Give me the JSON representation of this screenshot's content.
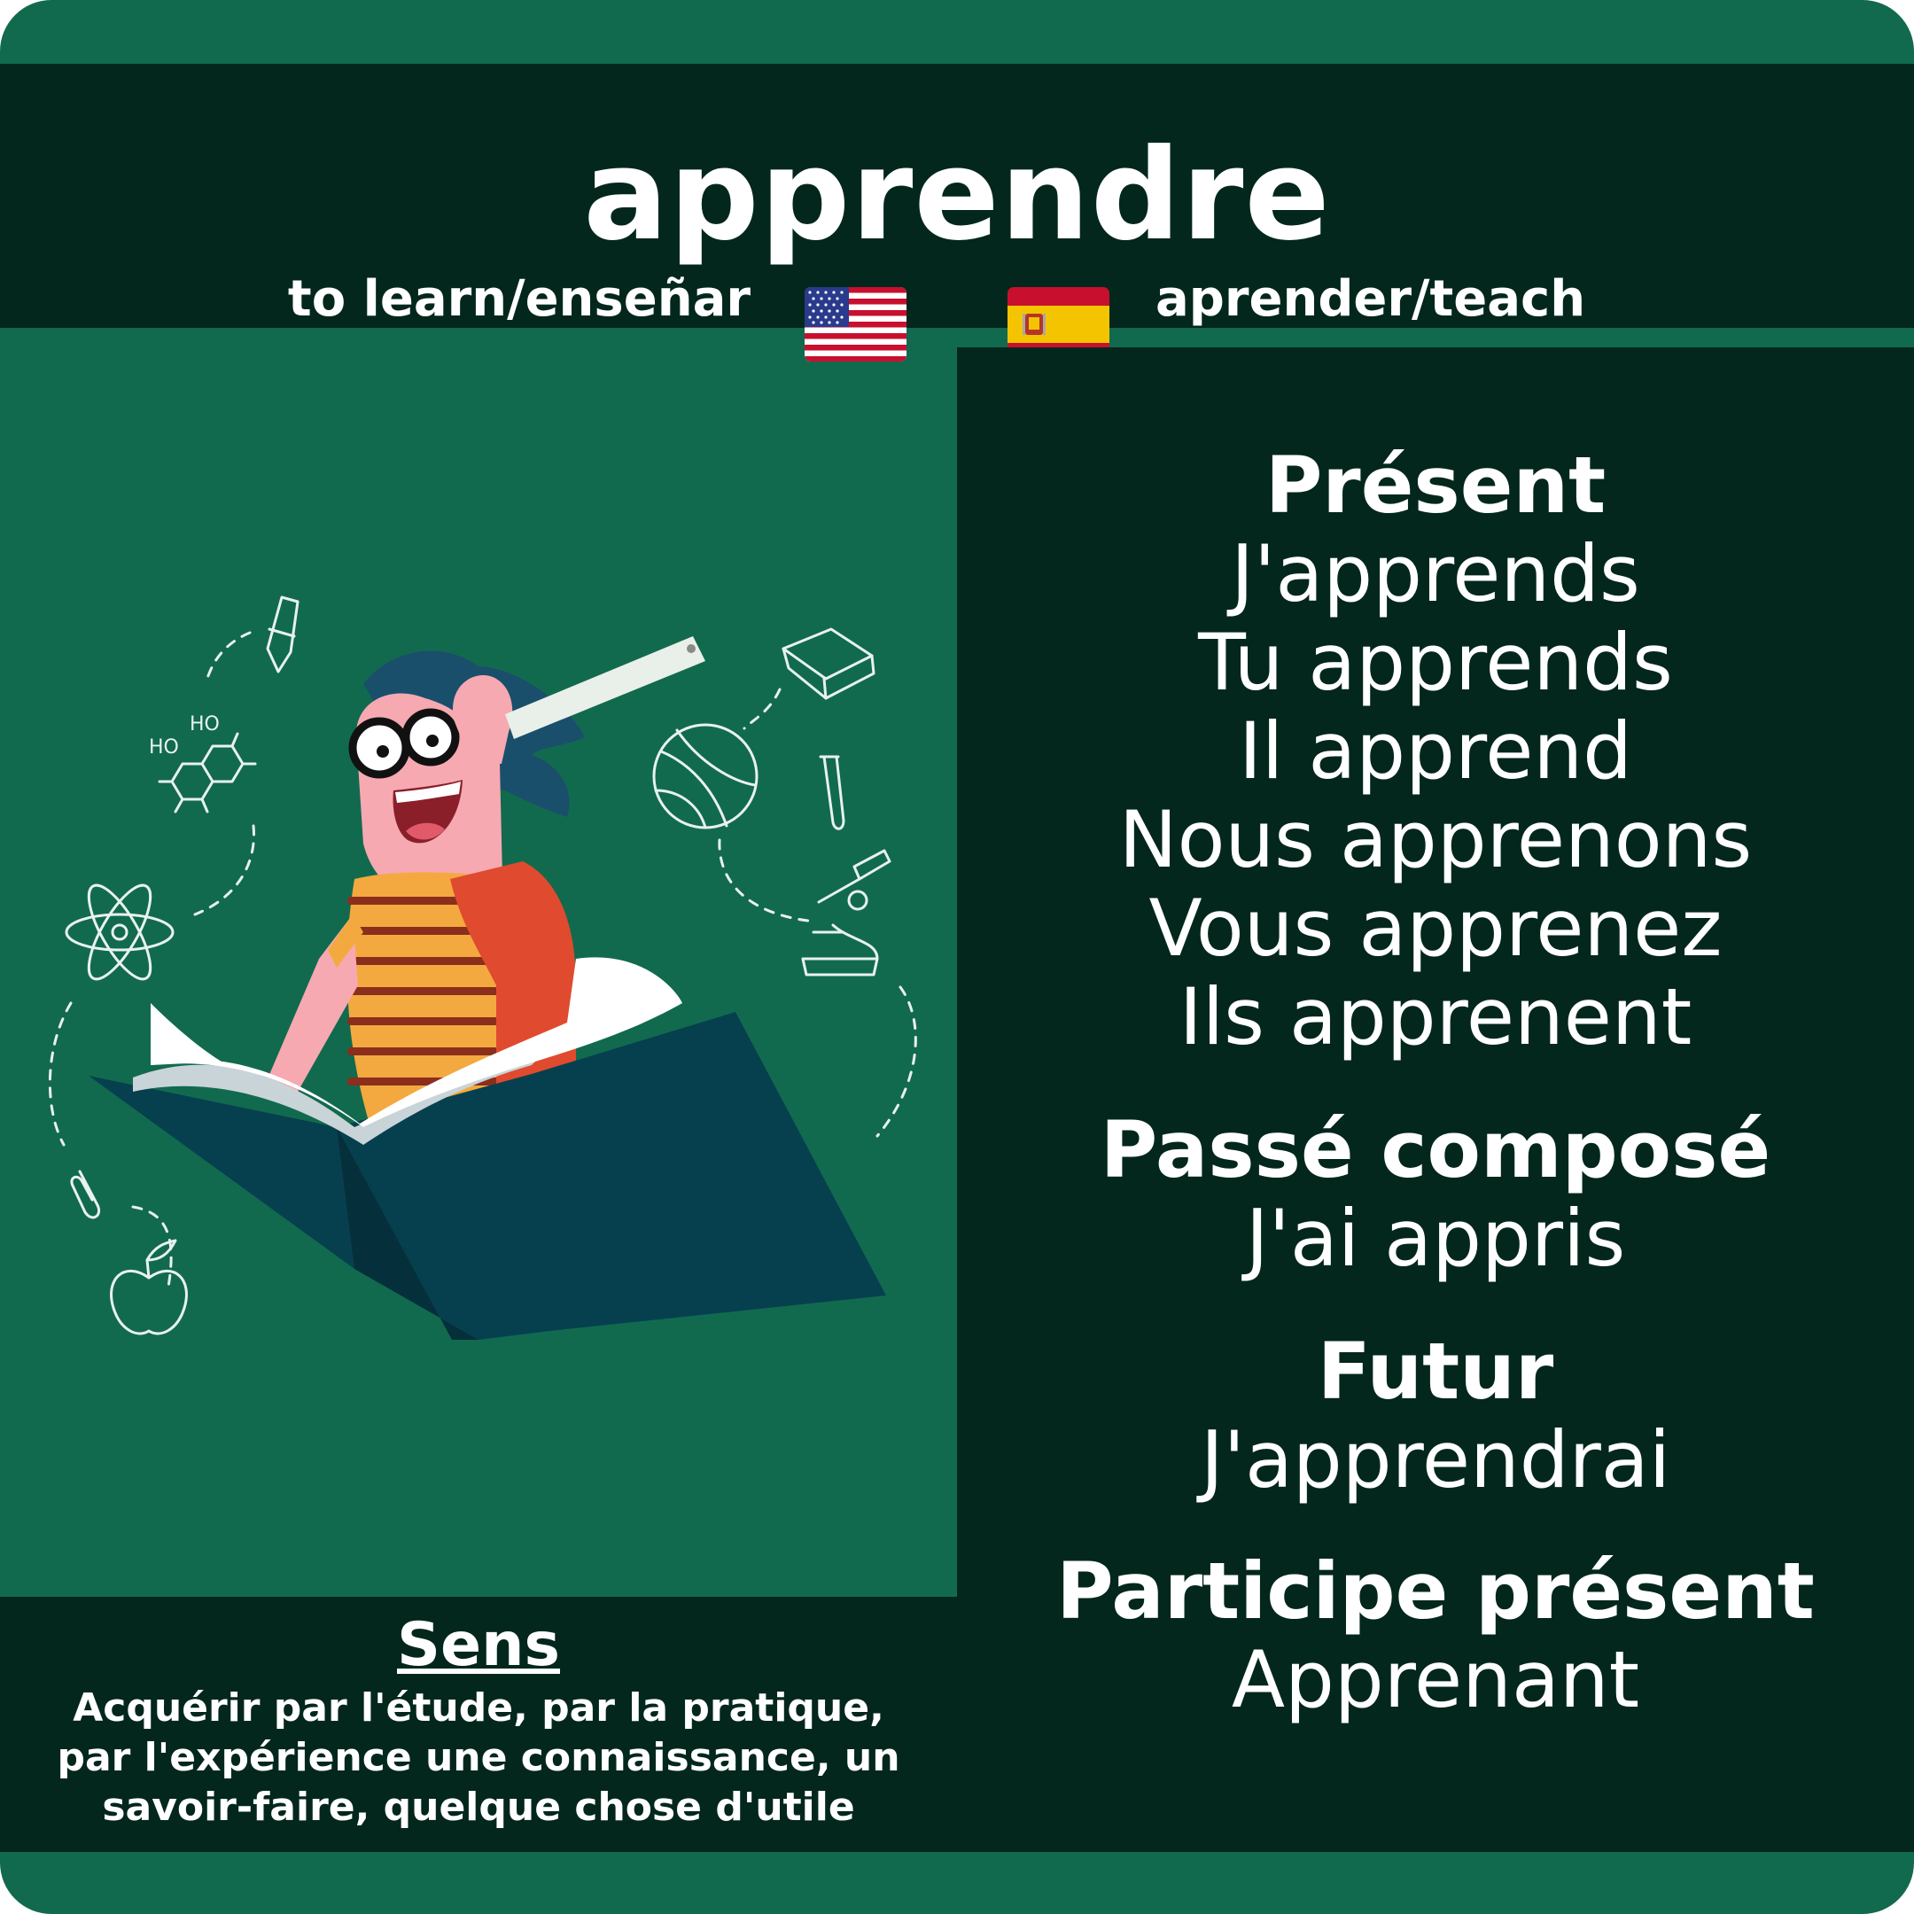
{
  "verb": "apprendre",
  "translations": {
    "english": "to learn/enseñar",
    "spanish": "aprender/teach"
  },
  "flags": {
    "english": "us-flag-icon",
    "spanish": "spain-flag-icon"
  },
  "conjugations": {
    "present": {
      "title": "Présent",
      "forms": [
        "J'apprends",
        "Tu apprends",
        "Il apprend",
        "Nous apprenons",
        "Vous apprenez",
        "Ils apprenent"
      ]
    },
    "passe_compose": {
      "title": "Passé composé",
      "form": "J'ai appris"
    },
    "futur": {
      "title": "Futur",
      "form": "J'apprendrai"
    },
    "participe_present": {
      "title": "Participe présent",
      "form": "Apprenant"
    }
  },
  "sens": {
    "title": "Sens",
    "line1": "Acquérir par l'étude, par la pratique,",
    "line2": "par l'expérience une connaissance, un",
    "line3": "savoir-faire, quelque chose d'utile"
  },
  "colors": {
    "card_green": "#126a4e",
    "panel_dark": "#03271d",
    "text": "#ffffff"
  }
}
